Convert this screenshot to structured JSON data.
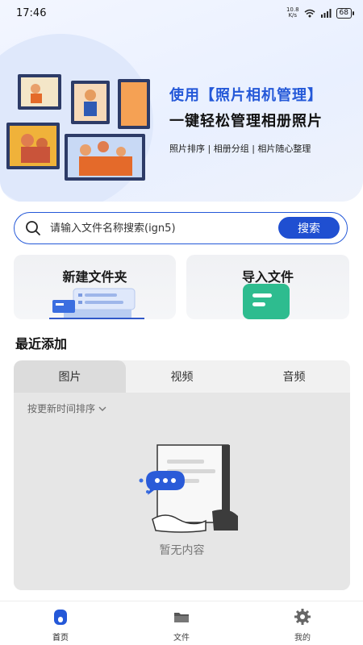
{
  "status": {
    "time": "17:46",
    "net_speed_value": "10.8",
    "net_speed_unit": "K/s",
    "battery": "68"
  },
  "hero": {
    "title1": "使用【照片相机管理】",
    "title2": "一键轻松管理相册照片",
    "subtitle": "照片排序 | 相册分组 | 相片随心整理"
  },
  "search": {
    "placeholder": "请输入文件名称搜索(ign5)",
    "button": "搜索"
  },
  "cards": {
    "new_folder": "新建文件夹",
    "import_file": "导入文件"
  },
  "recent": {
    "title": "最近添加",
    "tabs": [
      "图片",
      "视频",
      "音频"
    ],
    "active_tab": "图片",
    "sort_label": "按更新时间排序",
    "empty_text": "暂无内容"
  },
  "nav": {
    "items": [
      {
        "label": "首页",
        "icon": "home-icon",
        "active": true
      },
      {
        "label": "文件",
        "icon": "folder-icon",
        "active": false
      },
      {
        "label": "我的",
        "icon": "settings-icon",
        "active": false
      }
    ]
  },
  "colors": {
    "accent": "#1f4fd1",
    "hero_bg": "#eef3ff",
    "panel_bg": "#e6e6e6"
  }
}
